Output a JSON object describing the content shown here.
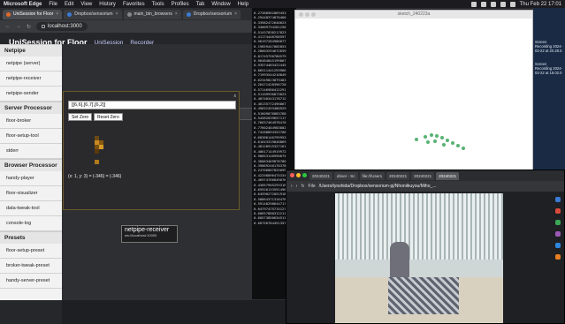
{
  "menubar": {
    "app": "Microsoft Edge",
    "items": [
      "File",
      "Edit",
      "View",
      "History",
      "Favorites",
      "Tools",
      "Profiles",
      "Tab",
      "Window",
      "Help"
    ],
    "clock": "Thu Feb 22 17:01"
  },
  "edge": {
    "tabs": [
      "UniSession for Floor",
      "Dropbox/sensorium",
      "main_bin_browsers",
      "Dropbox/sensorium"
    ],
    "url": "localhost:3000"
  },
  "app": {
    "title": "UniSession for Floor",
    "links": [
      "UniSession",
      "Recorder"
    ]
  },
  "sidebar": {
    "sections": [
      {
        "title": "Netpipe",
        "items": [
          "netpipe (server)",
          "netpipe-receiver",
          "netpipe-sender"
        ]
      },
      {
        "title": "Server Processor",
        "items": [
          "floor-broker",
          "floor-setup-tool",
          "stderr"
        ]
      },
      {
        "title": "Browser Processor",
        "items": [
          "handy-player",
          "floor-visualizer",
          "data-tweak-tool",
          "console-log"
        ]
      },
      {
        "title": "Presets",
        "items": [
          "floor-setup-preset",
          "broker-tweak-preset",
          "handy-server-preset"
        ]
      }
    ]
  },
  "node": {
    "field_value": "[[6,6],[6,7],[6,2]]",
    "set_zero": "Set Zero",
    "reset_zero": "Reset Zero",
    "coord": "(x: 1, y: 3) = (-346) = (-346)",
    "close": "x"
  },
  "ghost": {
    "label": "floor-visualizer"
  },
  "receiver": {
    "title": "netpipe-receiver",
    "url": "ws://localhost:10000"
  },
  "terminal": {
    "lines": [
      "0.27388902869453",
      "0.29448374870466",
      "0.33982472640023",
      "0.34009734281256",
      "0.51437838217823",
      "0.41174448768597",
      "0.56197284986877",
      "0.19859447085853",
      "0.28603294672659",
      "0.81745750780579",
      "0.96484845199867",
      "0.93574483422445",
      "0.86511441293966",
      "0.71993544210849",
      "0.62349823879483",
      "0.26471428396728",
      "0.57146980412291",
      "0.51109936873823",
      "0.48748343178712",
      "0.46135772496867",
      "0.49652493480929",
      "0.51609076883768",
      "0.54582039657117",
      "0.76637464978470",
      "0.77602484983802",
      "0.74288894353706",
      "0.68386146799953",
      "0.61643319840869",
      "0.48128915327161",
      "0.48617144919972",
      "0.90853148990075",
      "0.38063469878786",
      "0.39869240178378",
      "0.24766807825099",
      "0.42298896475334",
      "0.46974766849078",
      "0.43057905293316",
      "0.65920133591496",
      "0.64590272051918",
      "0.50864371316478",
      "0.59148298644717",
      "0.64797475715127",
      "0.60657880312211",
      "0.60573850634511",
      "0.60750784451357"
    ]
  },
  "sketch": {
    "title": "sketch_240223a"
  },
  "desk": {
    "labels": [
      "Screen Recording 2024-02-22 at 20.28.5",
      "Screen Recording 2024-02-22 at 19.02.0"
    ]
  },
  "video_window": {
    "tabs": [
      "20240221",
      "driver - Sc",
      "file:///Users",
      "20240221",
      "20240221",
      "20240221"
    ],
    "file_label": "File",
    "url": "/Users/tyoshida/Dropbox/sensorium-pj/Nhoniikuyou/Miho_..."
  },
  "colors": {
    "node_border": "#6a5a2a",
    "dot": "#3ba55c",
    "brown": "#8a5a10",
    "orange": "#d79a2a"
  }
}
